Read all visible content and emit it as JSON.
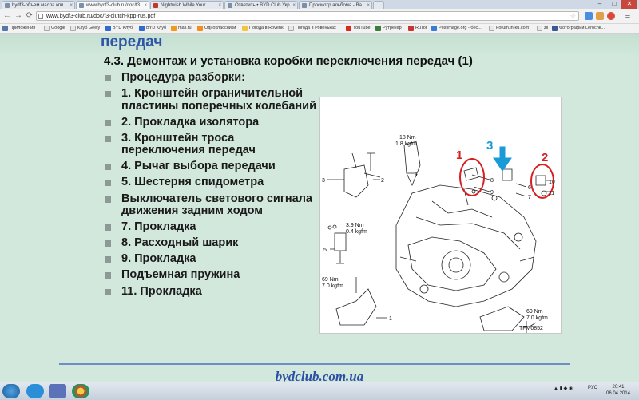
{
  "browser": {
    "tabs": [
      {
        "title": "bydf3-объем масла кпп"
      },
      {
        "title": "www.bydf3-club.ru/doc/f3"
      },
      {
        "title": "Nightwish While Your"
      },
      {
        "title": "Ответить • BYD Club Укр"
      },
      {
        "title": "Просмотр альбома - Ва"
      }
    ],
    "window_controls": {
      "minimize": "–",
      "maximize": "□",
      "close": "✕"
    },
    "url": "www.bydf3-club.ru/doc/f3-clutch-kpp-rus.pdf",
    "bookmarks": [
      {
        "label": "Приложения"
      },
      {
        "label": "Google"
      },
      {
        "label": "Клуб Geely"
      },
      {
        "label": "BYD Клуб"
      },
      {
        "label": "BYD Клуб"
      },
      {
        "label": "mail.ru"
      },
      {
        "label": "Одноклассники"
      },
      {
        "label": "Погода в Rovenki"
      },
      {
        "label": "Погода в Ровеньках"
      },
      {
        "label": "YouTube"
      },
      {
        "label": "Рутрекер"
      },
      {
        "label": "RuTor"
      },
      {
        "label": "Postimage.org - бес..."
      },
      {
        "label": "Forum.in-ku.com"
      },
      {
        "label": "zlі"
      },
      {
        "label": "Фотографии Lerochk..."
      }
    ]
  },
  "slide": {
    "partial_title": "передач",
    "subtitle": "4.3. Демонтаж и установка коробки переключения передач (1)",
    "items": [
      "Процедура разборки:",
      "1. Кронштейн ограничительной пластины поперечных колебаний",
      "2. Прокладка изолятора",
      "3. Кронштейн троса переключения передач",
      "4. Рычаг выбора передачи",
      "5. Шестерня спидометра",
      "Выключатель светового сигнала движения задним ходом",
      "7. Прокладка",
      "8. Расходный шарик",
      "9. Прокладка",
      "Подъемная пружина",
      "11. Прокладка"
    ],
    "figure": {
      "torque_top": [
        "18 Nm",
        "1.8 kgfm"
      ],
      "torque_mid": [
        "3.9 Nm",
        "0.4 kgfm"
      ],
      "torque_left": [
        "69 Nm",
        "7.0 kgfm"
      ],
      "torque_right": [
        "69 Nm",
        "7.0 kgfm"
      ],
      "callouts": [
        "1",
        "2",
        "3",
        "4",
        "5",
        "6",
        "7",
        "8",
        "9",
        "10",
        "11"
      ],
      "red_marks": [
        "1",
        "2"
      ],
      "blue_mark": "3",
      "code": "TFM0852",
      "colors": {
        "red": "#d81e1e",
        "blue": "#1a9ad6"
      }
    },
    "watermark": "bydclub.com.ua"
  },
  "taskbar": {
    "lang": "РУС",
    "time": "20:41",
    "date": "06.04.2014"
  }
}
